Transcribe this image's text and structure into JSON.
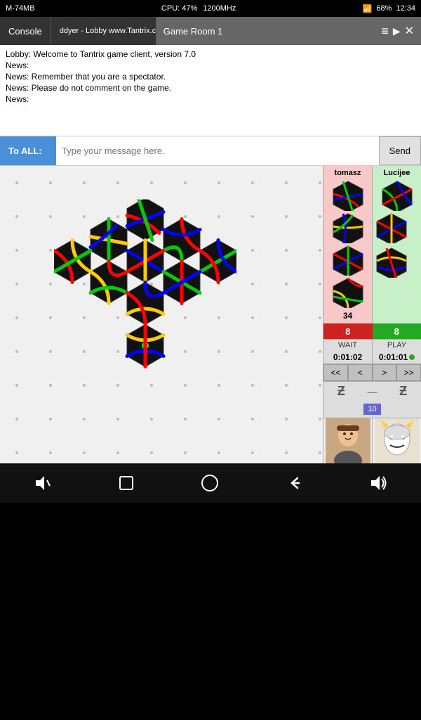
{
  "status_bar": {
    "wifi_icon": "wifi",
    "battery": "68%",
    "time": "12:34",
    "memory": "M-74MB",
    "cpu": "CPU: 47%",
    "freq": "1200MHz"
  },
  "tabs": [
    {
      "id": "console",
      "label": "Console",
      "active": false
    },
    {
      "id": "lobby",
      "label": "ddyer - Lobby www.Tantrix.com",
      "active": false
    },
    {
      "id": "gameroom",
      "label": "Game Room 1",
      "active": true
    }
  ],
  "tab_icons": {
    "menu": "≡",
    "close": "✕",
    "more": "▶"
  },
  "chat": {
    "lines": [
      "Lobby: Welcome to Tantrix game client, version 7.0",
      "News:",
      "News: Remember that you are a spectator.",
      "News: Please do not comment on the game.",
      "News:"
    ]
  },
  "message_bar": {
    "to_label": "To ALL:",
    "placeholder": "Type your message here.",
    "send_label": "Send"
  },
  "players": [
    {
      "name": "tomasz",
      "score": "34",
      "badge": "8",
      "status": "WAIT",
      "timer": "0:01:02",
      "timer_dot": false
    },
    {
      "name": "Lucijee",
      "score": "",
      "badge": "8",
      "status": "PLAY",
      "timer": "0:01:01",
      "timer_dot": true
    }
  ],
  "nav_buttons": [
    "<<",
    "<",
    ">",
    ">>"
  ],
  "move_counter": "10",
  "z_symbols": [
    "Ƶ",
    "—",
    "Ƶ"
  ],
  "bottom_nav": {
    "volume_down": "🔈",
    "home_square": "⬜",
    "home": "⌂",
    "back": "↩",
    "volume_up": "🔊"
  }
}
